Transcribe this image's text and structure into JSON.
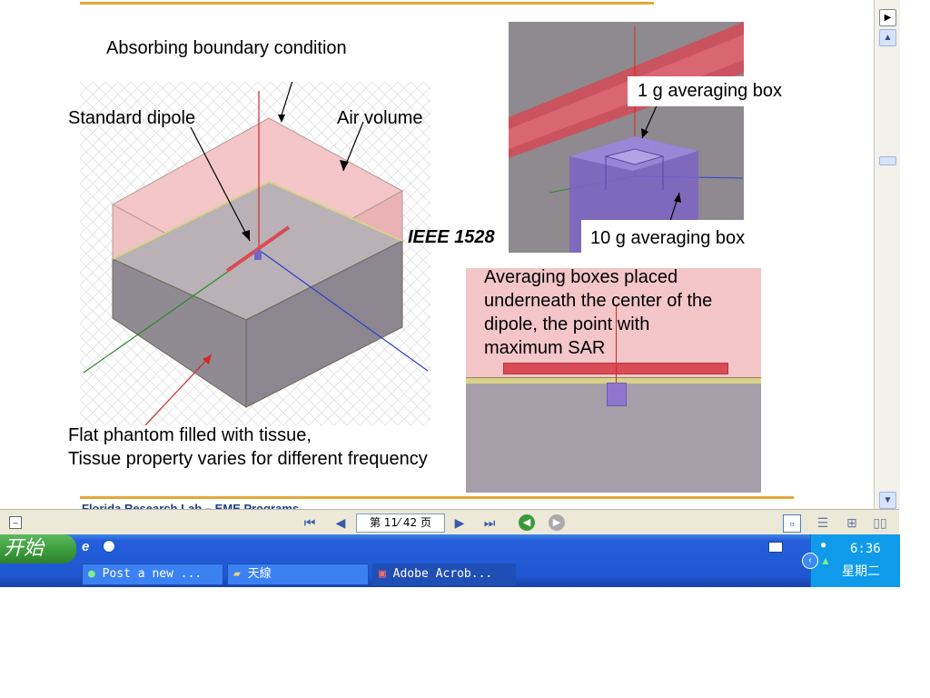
{
  "slide": {
    "labels": {
      "absorbing": "Absorbing boundary condition",
      "dipole": "Standard dipole",
      "air": "Air volume",
      "phantom_line1": "Flat phantom filled with tissue,",
      "phantom_line2": "Tissue property varies for different frequency",
      "ieee": "IEEE 1528",
      "box1g": "1 g averaging box",
      "box10g": "10 g averaging box",
      "caption_lines": [
        "Averaging boxes placed",
        "underneath the center of the",
        "dipole, the point with",
        "maximum SAR"
      ]
    },
    "footer_text": "Florida Research Lab – EME Programs",
    "accent_color": "#e5a63a"
  },
  "acrobat_toolbar": {
    "page_field": "第 11⁄ 42 页"
  },
  "taskbar": {
    "start_label": "开始",
    "tasks": [
      {
        "label": "Post a new ...",
        "icon": "ie-icon"
      },
      {
        "label": "天線",
        "icon": "folder-icon"
      },
      {
        "label": "Adobe Acrob...",
        "icon": "acrobat-icon"
      }
    ],
    "clock": "6:36",
    "day": "星期二"
  },
  "colors": {
    "taskbar": "#245edb",
    "start": "#3a9a3a",
    "tray": "#0f9bea",
    "phantom_pink": "#f4c6c8"
  }
}
